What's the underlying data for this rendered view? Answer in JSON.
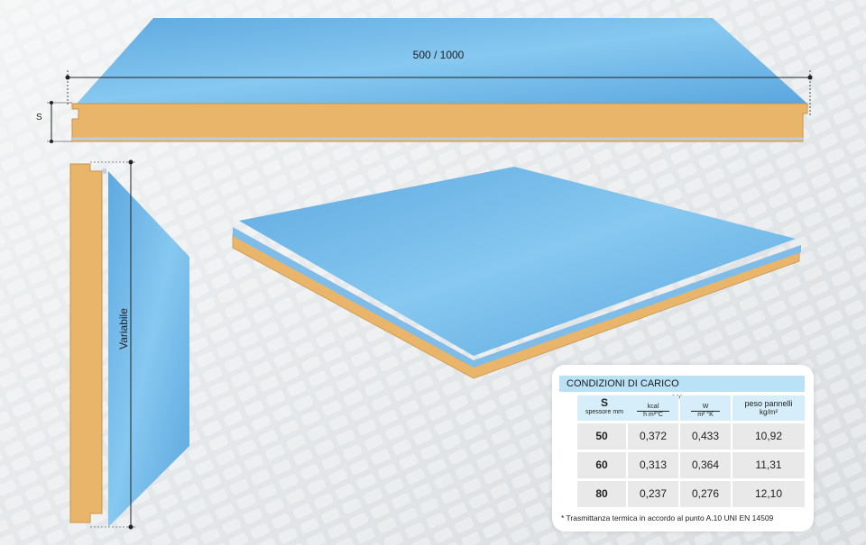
{
  "dimensions": {
    "width_label": "500 / 1000",
    "thickness_label": "S",
    "length_label": "Variabile"
  },
  "colors": {
    "panel_top": "#6fb7e6",
    "foam": "#e8b56a",
    "table_header": "#b9e2f7",
    "table_cell": "#e9e9ea"
  },
  "table": {
    "title": "CONDIZIONI DI CARICO",
    "s_header": "S",
    "s_sub": "spessore mm",
    "u_header": "U*",
    "kcal_num": "kcal",
    "kcal_den": "h m²°C",
    "w_num": "W",
    "w_den": "m² °K",
    "weight_header": "peso pannelli",
    "weight_unit": "kg/m²",
    "rows": [
      {
        "s": "50",
        "kcal": "0,372",
        "w": "0,433",
        "peso": "10,92"
      },
      {
        "s": "60",
        "kcal": "0,313",
        "w": "0,364",
        "peso": "11,31"
      },
      {
        "s": "80",
        "kcal": "0,237",
        "w": "0,276",
        "peso": "12,10"
      }
    ],
    "footnote": "* Trasmittanza termica in accordo al punto A.10 UNI EN 14509"
  }
}
